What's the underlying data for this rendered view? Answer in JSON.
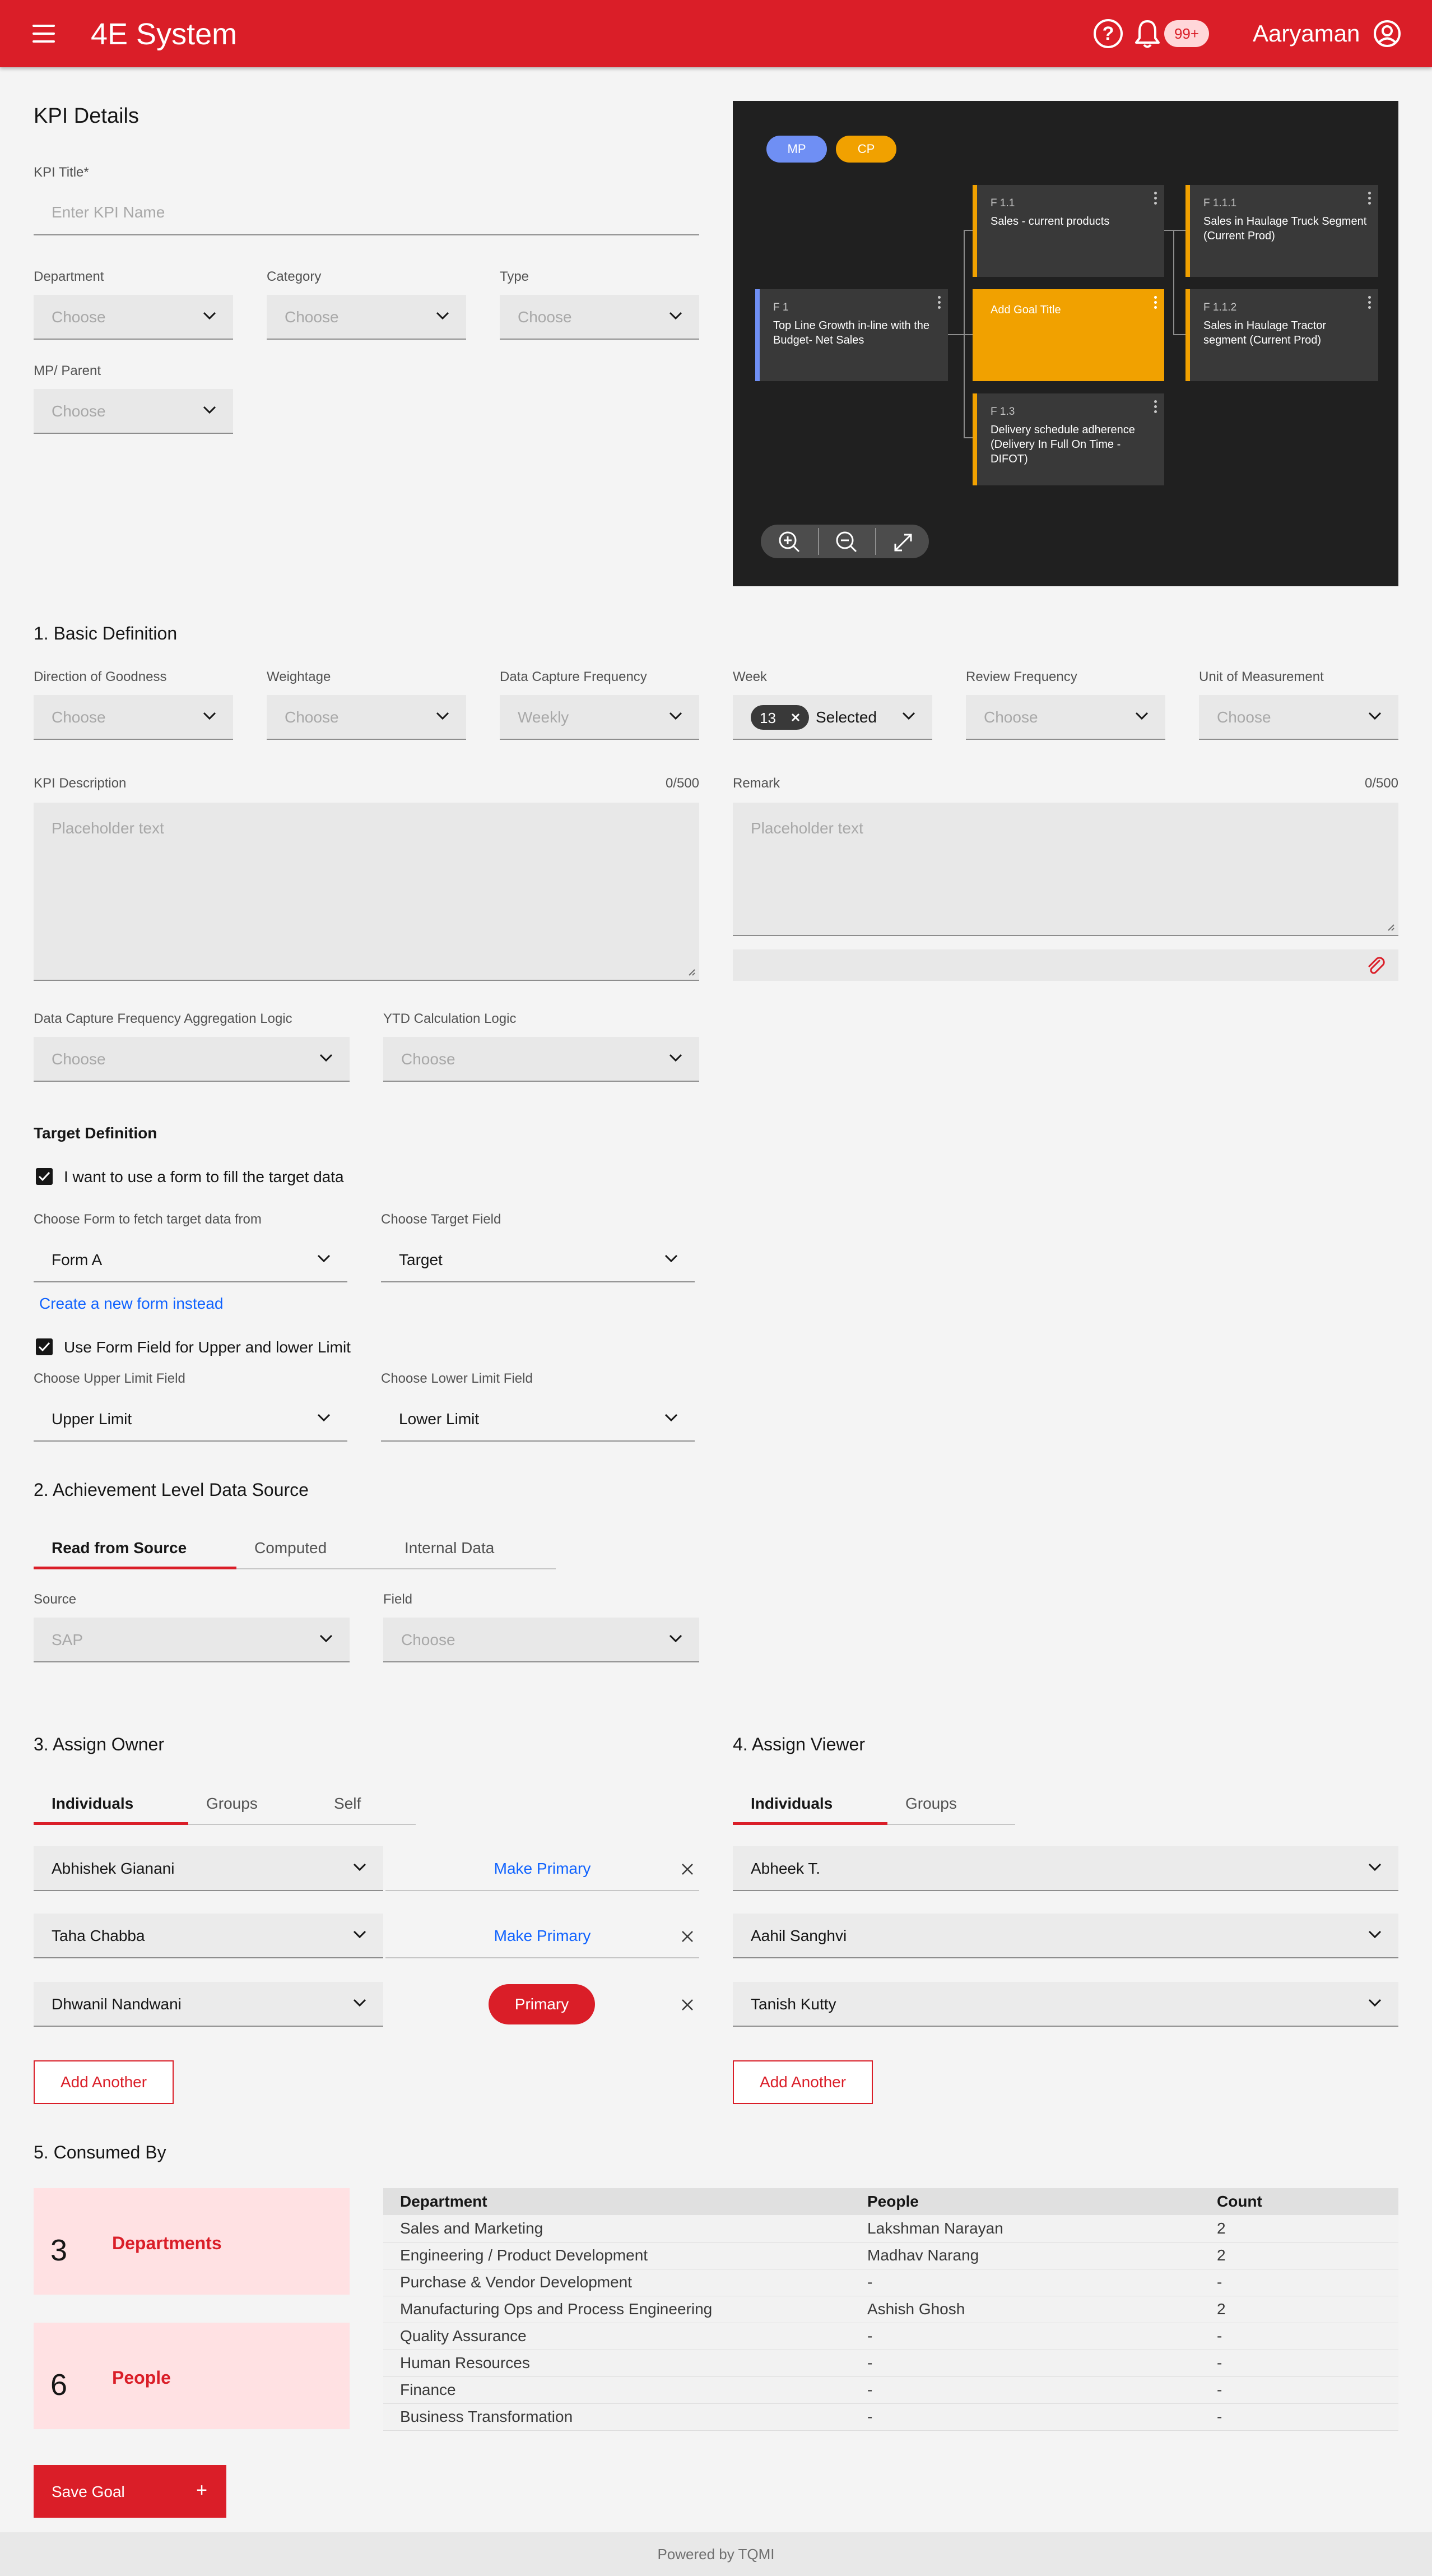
{
  "header": {
    "brand": "4E System",
    "badge": "99+",
    "user": "Aaryaman"
  },
  "kpi": {
    "heading": "KPI Details",
    "title_label": "KPI Title*",
    "title_placeholder": "Enter KPI Name",
    "department_label": "Department",
    "category_label": "Category",
    "type_label": "Type",
    "parent_label": "MP/ Parent",
    "choose": "Choose"
  },
  "tree": {
    "legend_mp": "MP",
    "legend_cp": "CP",
    "nodes": {
      "f1": {
        "code": "F 1",
        "title": "Top Line Growth in-line with the Budget- Net Sales"
      },
      "f11": {
        "code": "F 1.1",
        "title": "Sales - current products"
      },
      "goal": {
        "title": "Add Goal Title"
      },
      "f13": {
        "code": "F 1.3",
        "title": "Delivery schedule adherence (Delivery In Full On Time - DIFOT)"
      },
      "f111": {
        "code": "F 1.1.1",
        "title": "Sales in Haulage Truck Segment (Current Prod)"
      },
      "f112": {
        "code": "F 1.1.2",
        "title": "Sales in Haulage Tractor segment  (Current Prod)"
      }
    },
    "colors": {
      "mp": "#6f8ff4",
      "cp": "#f1a100"
    }
  },
  "basic": {
    "heading": "1. Basic Definition",
    "direction_label": "Direction of Goodness",
    "weightage_label": "Weightage",
    "capture_label": "Data Capture Frequency",
    "capture_value": "Weekly",
    "week_label": "Week",
    "week_count": "13",
    "week_selected": "Selected",
    "review_label": "Review Frequency",
    "uom_label": "Unit of Measurement",
    "desc_label": "KPI Description",
    "desc_counter": "0/500",
    "remark_label": "Remark",
    "remark_counter": "0/500",
    "placeholder": "Placeholder text",
    "agg_label": "Data Capture Frequency Aggregation Logic",
    "ytd_label": "YTD Calculation Logic"
  },
  "target": {
    "heading": "Target Definition",
    "use_form_label": "I want to use a form to fill the target data",
    "form_label": "Choose Form to fetch target data from",
    "form_value": "Form A",
    "field_label": "Choose Target Field",
    "field_value": "Target",
    "create_link": "Create a new form instead",
    "limit_label": "Use Form Field for Upper and lower Limit",
    "upper_label": "Choose Upper Limit Field",
    "upper_value": "Upper Limit",
    "lower_label": "Choose Lower Limit Field",
    "lower_value": "Lower Limit"
  },
  "achievement": {
    "heading": "2. Achievement Level Data Source",
    "tabs": [
      "Read from Source",
      "Computed",
      "Internal Data"
    ],
    "source_label": "Source",
    "source_value": "SAP",
    "field_label": "Field",
    "field_value": "Choose"
  },
  "owner": {
    "heading": "3. Assign Owner",
    "tabs": [
      "Individuals",
      "Groups",
      "Self"
    ],
    "rows": [
      {
        "name": "Abhishek Gianani",
        "action": "Make Primary"
      },
      {
        "name": "Taha Chabba",
        "action": "Make Primary"
      },
      {
        "name": "Dhwanil Nandwani",
        "action": "Primary"
      }
    ],
    "add": "Add Another"
  },
  "viewer": {
    "heading": "4. Assign Viewer",
    "tabs": [
      "Individuals",
      "Groups"
    ],
    "rows": [
      "Abheek T.",
      "Aahil Sanghvi",
      "Tanish Kutty"
    ],
    "add": "Add Another"
  },
  "consumed": {
    "heading": "5. Consumed By",
    "cards": [
      {
        "count": "3",
        "label": "Departments"
      },
      {
        "count": "6",
        "label": "People"
      }
    ],
    "columns": [
      "Department",
      "People",
      "Count"
    ],
    "rows": [
      [
        "Sales and Marketing",
        "Lakshman Narayan",
        "2"
      ],
      [
        "Engineering / Product Development",
        "Madhav Narang",
        "2"
      ],
      [
        "Purchase & Vendor Development",
        "-",
        "-"
      ],
      [
        "Manufacturing Ops and Process Engineering",
        "Ashish Ghosh",
        "2"
      ],
      [
        "Quality Assurance",
        "-",
        "-"
      ],
      [
        "Human Resources",
        "-",
        "-"
      ],
      [
        "Finance",
        "-",
        "-"
      ],
      [
        "Business Transformation",
        "-",
        "-"
      ]
    ]
  },
  "save": {
    "label": "Save Goal",
    "icon": "+"
  },
  "footer": {
    "text": "Powered by TQMI"
  }
}
